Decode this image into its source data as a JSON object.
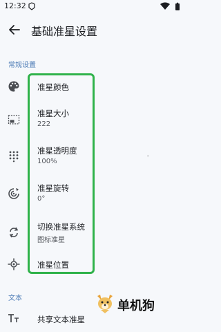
{
  "status_bar": {
    "time": "12:32"
  },
  "app_bar": {
    "title": "基础准星设置"
  },
  "sections": {
    "general": "常规设置",
    "text": "文本"
  },
  "items": [
    {
      "title": "准星颜色",
      "subtitle": "",
      "icon": "palette-icon"
    },
    {
      "title": "准星大小",
      "subtitle": "222",
      "icon": "resize-icon"
    },
    {
      "title": "准星透明度",
      "subtitle": "100%",
      "icon": "grid-dots-icon"
    },
    {
      "title": "准星旋转",
      "subtitle": "0°",
      "icon": "rotate-icon"
    },
    {
      "title": "切换准星系统",
      "subtitle": "图标准星",
      "icon": "swap-icon"
    },
    {
      "title": "准星位置",
      "subtitle": "",
      "icon": "crosshair-icon"
    },
    {
      "title": "共享文本准星",
      "subtitle": "",
      "icon": "text-size-icon"
    }
  ],
  "watermark": {
    "text": "单机狗"
  },
  "colors": {
    "accent": "#4c7bb6",
    "highlight": "#2fb24a",
    "background": "#f6f8fb"
  }
}
